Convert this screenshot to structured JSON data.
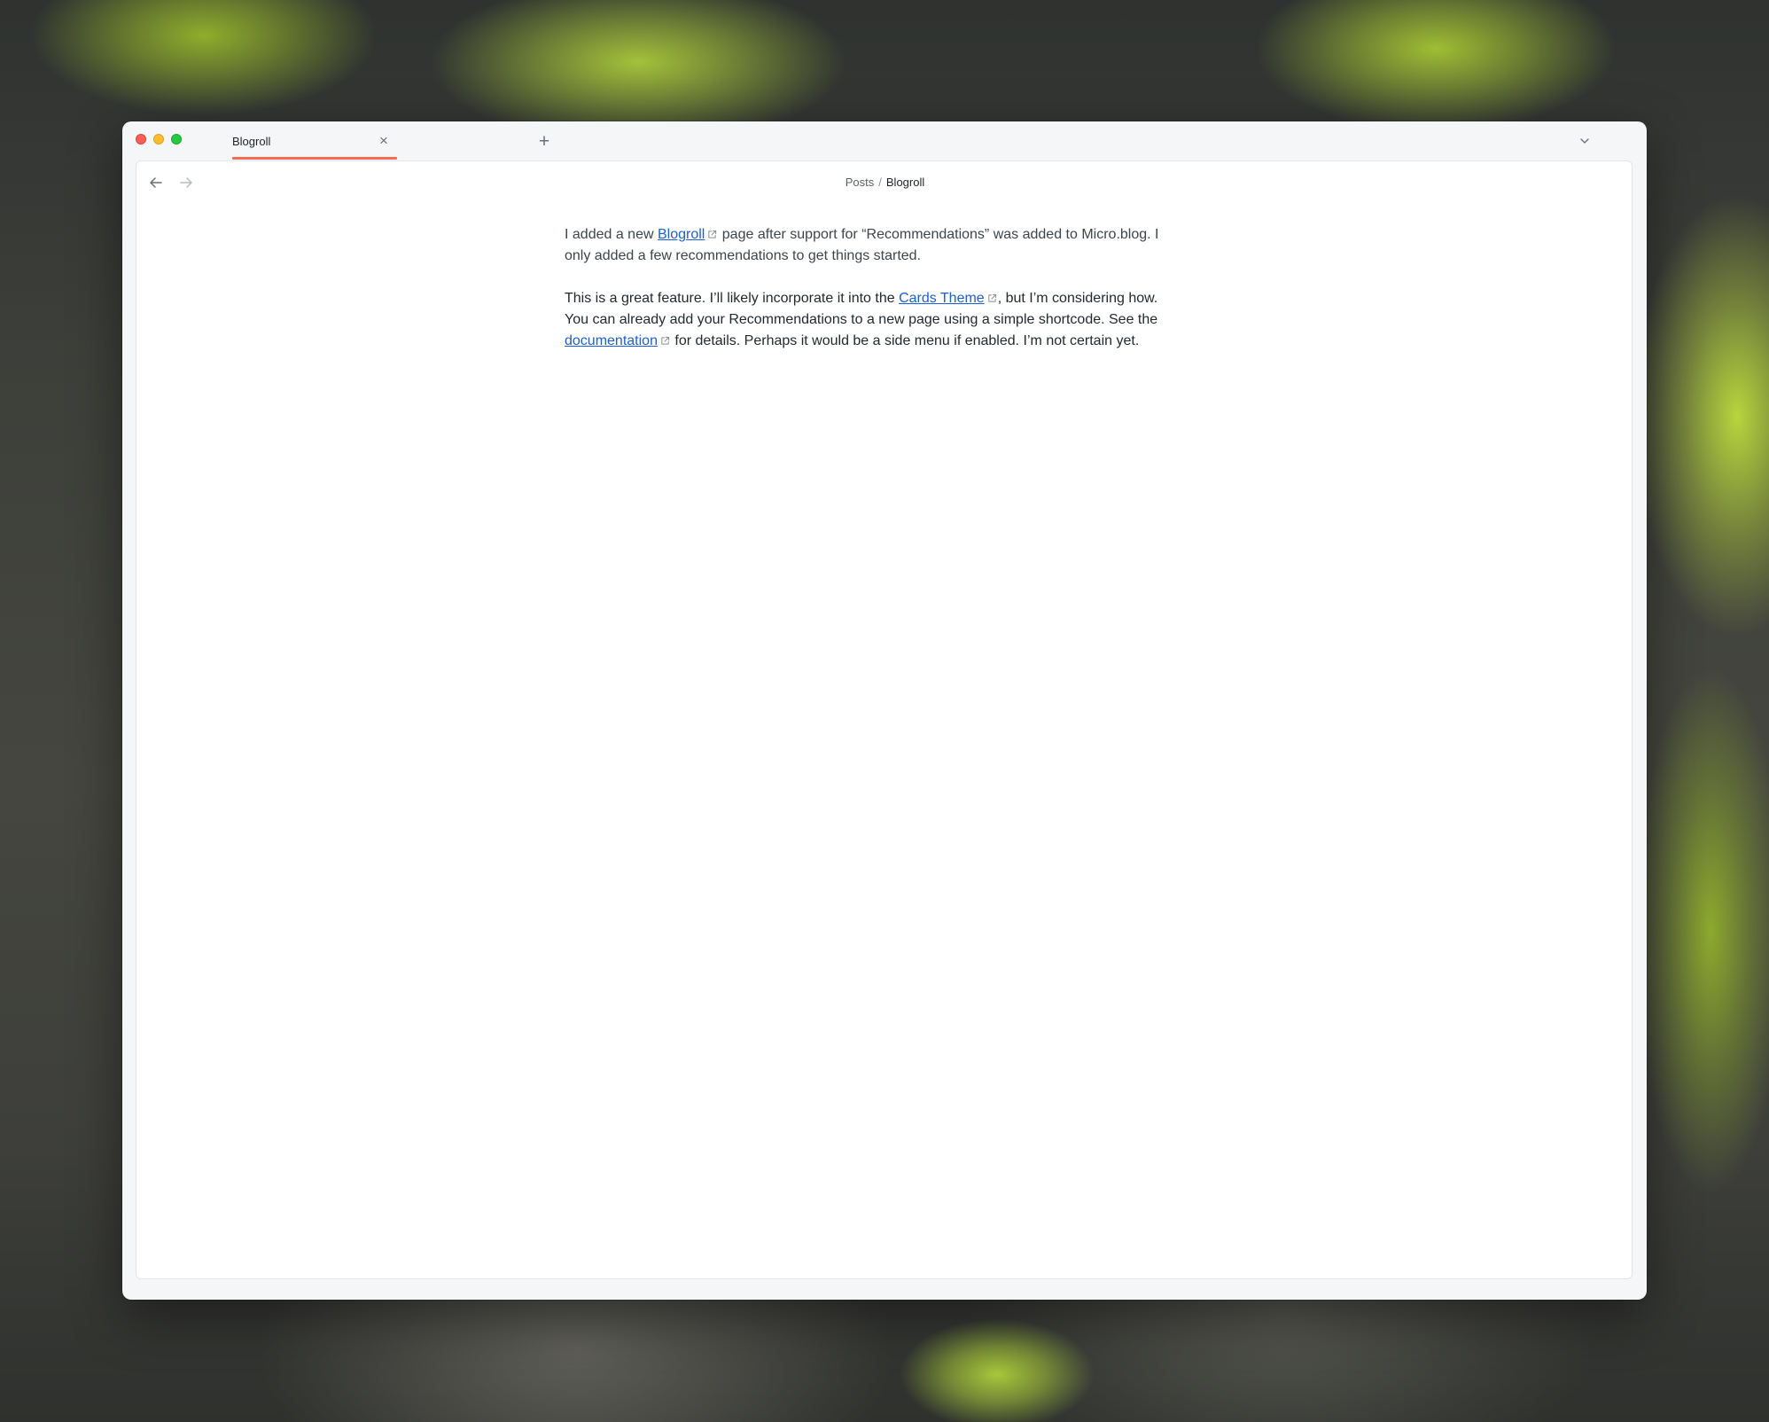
{
  "window": {
    "tab": {
      "title": "Blogroll",
      "close_label": "×"
    },
    "new_tab_label": "+"
  },
  "navigation": {
    "breadcrumb": {
      "parent": "Posts",
      "separator": "/",
      "current": "Blogroll"
    }
  },
  "post": {
    "paragraph1": {
      "before_link": "I added a new ",
      "link_text": "Blogroll",
      "after_link": " page after support for “Recommendations” was added to Micro.blog. I only added a few recommendations to get things started."
    },
    "paragraph2": {
      "before_link1": "This is a great feature. I’ll likely incorporate it into the ",
      "link1_text": "Cards Theme",
      "between_links": ", but I’m considering how. You can already add your Recommendations to a new page using a simple shortcode. See the ",
      "link2_text": "documentation",
      "after_link2": " for details. Perhaps it would be a side menu if enabled. I’m not certain yet."
    }
  },
  "icons": {
    "back": "arrow-left-icon",
    "forward": "arrow-right-icon",
    "external_link": "external-link-icon",
    "menu": "chevron-down-icon"
  },
  "colors": {
    "accent": "#f26c4f",
    "link": "#1d5fd1"
  }
}
